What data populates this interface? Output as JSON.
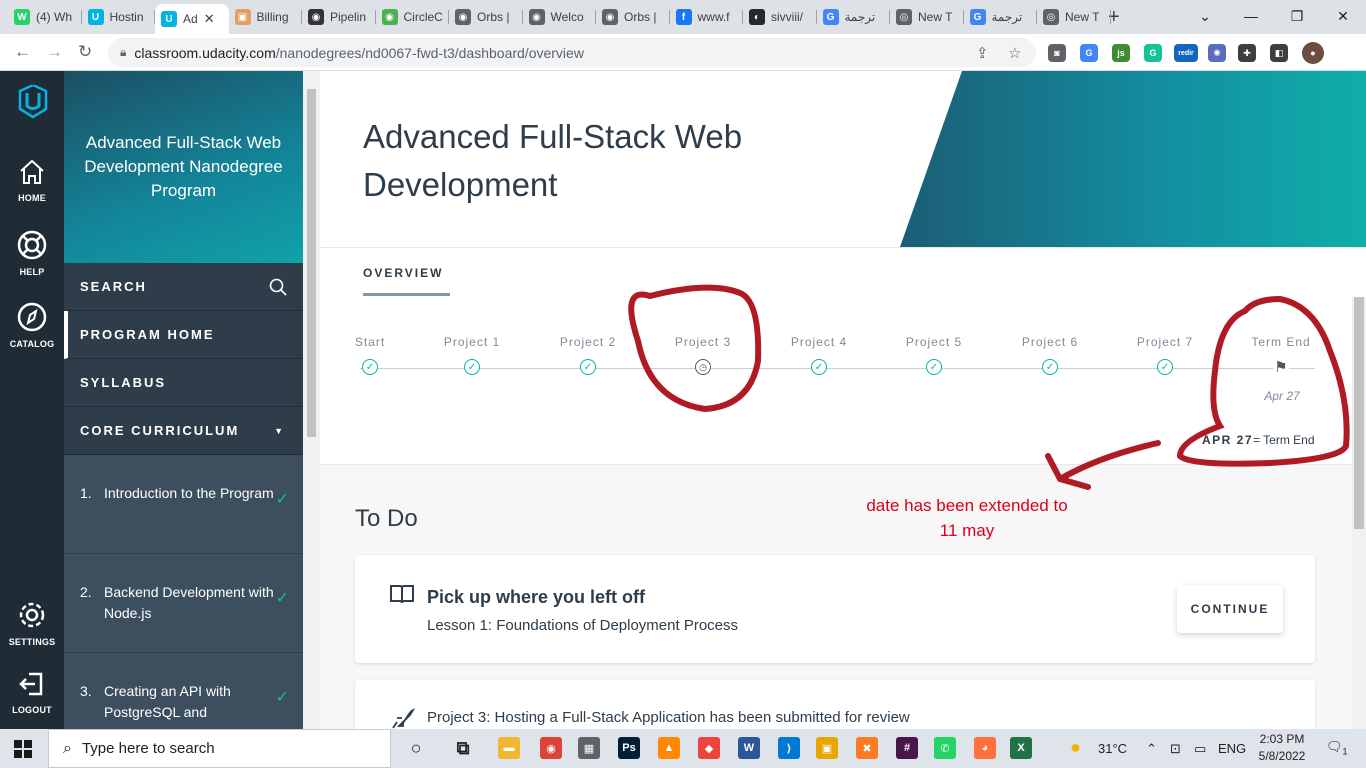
{
  "browser": {
    "tabs": [
      {
        "label": "(4) Wh",
        "icon": "whatsapp-icon",
        "color": "#25d366",
        "glyph": "W"
      },
      {
        "label": "Hostin",
        "icon": "udacity-icon",
        "color": "#02b3e4",
        "glyph": "U"
      },
      {
        "label": "Ad",
        "icon": "udacity-icon",
        "color": "#02b3e4",
        "glyph": "U",
        "active": true
      },
      {
        "label": "Billing",
        "icon": "box-icon",
        "color": "#e0a060",
        "glyph": "▣"
      },
      {
        "label": "Pipelin",
        "icon": "circleci-icon",
        "color": "#343434",
        "glyph": "◉"
      },
      {
        "label": "CircleC",
        "icon": "circleci-green-icon",
        "color": "#4caf50",
        "glyph": "◉"
      },
      {
        "label": "Orbs |",
        "icon": "circleci-icon",
        "color": "#5f6368",
        "glyph": "◉"
      },
      {
        "label": "Welco",
        "icon": "circleci-icon",
        "color": "#5f6368",
        "glyph": "◉"
      },
      {
        "label": "Orbs |",
        "icon": "circleci-icon",
        "color": "#5f6368",
        "glyph": "◉"
      },
      {
        "label": "www.f",
        "icon": "facebook-icon",
        "color": "#1877f2",
        "glyph": "f"
      },
      {
        "label": "sivviii/",
        "icon": "github-icon",
        "color": "#24292e",
        "glyph": "◐"
      },
      {
        "label": "ترجمة",
        "icon": "translate-icon",
        "color": "#4285f4",
        "glyph": "G"
      },
      {
        "label": "New T",
        "icon": "chrome-icon",
        "color": "#5f6368",
        "glyph": "◎"
      },
      {
        "label": "ترجمة",
        "icon": "translate-icon",
        "color": "#4285f4",
        "glyph": "G"
      },
      {
        "label": "New T",
        "icon": "chrome-icon",
        "color": "#5f6368",
        "glyph": "◎"
      }
    ],
    "new_tab": "+",
    "window_controls": {
      "dropdown": "⌄",
      "minimize": "—",
      "restore": "❐",
      "close": "✕"
    },
    "nav": {
      "back": "←",
      "forward": "→",
      "reload": "↻"
    },
    "url_host": "classroom.udacity.com",
    "url_path": "/nanodegrees/nd0067-fwd-t3/dashboard/overview",
    "extensions": [
      {
        "name": "camera-icon",
        "glyph": "◙",
        "color": "#5f6368"
      },
      {
        "name": "translate-ext-icon",
        "glyph": "G",
        "color": "#4285f4"
      },
      {
        "name": "js-ext-icon",
        "glyph": "js",
        "color": "#3c8d2f"
      },
      {
        "name": "grammarly-icon",
        "glyph": "G",
        "color": "#15c39a"
      },
      {
        "name": "redirect-ext-icon",
        "glyph": "redir",
        "color": "#1565c0"
      },
      {
        "name": "gear-ext-icon",
        "glyph": "✺",
        "color": "#5c6bc0",
        "badge": "2"
      },
      {
        "name": "puzzle-icon",
        "glyph": "✚",
        "color": "#3c4043"
      },
      {
        "name": "sidepanel-icon",
        "glyph": "◧",
        "color": "#3c4043"
      },
      {
        "name": "profile-avatar",
        "glyph": "●",
        "color": "#6d4c41"
      }
    ]
  },
  "rail": {
    "items": [
      {
        "label": "HOME",
        "icon": "home-icon"
      },
      {
        "label": "HELP",
        "icon": "lifebuoy-icon"
      },
      {
        "label": "CATALOG",
        "icon": "compass-icon"
      },
      {
        "label": "SETTINGS",
        "icon": "gear-icon"
      },
      {
        "label": "LOGOUT",
        "icon": "logout-icon"
      }
    ]
  },
  "sidebar": {
    "program_title": "Advanced Full-Stack Web Development Nanodegree Program",
    "search_label": "SEARCH",
    "program_home": "PROGRAM HOME",
    "syllabus": "SYLLABUS",
    "core_curriculum": "CORE CURRICULUM",
    "lessons": [
      {
        "num": "1.",
        "title": "Introduction to the Program",
        "done": "✓"
      },
      {
        "num": "2.",
        "title": "Backend Development with Node.js",
        "done": "✓"
      },
      {
        "num": "3.",
        "title": "Creating an API with PostgreSQL and",
        "done": "✓"
      }
    ]
  },
  "main": {
    "title": "Advanced Full-Stack Web Development",
    "overview_tab": "OVERVIEW",
    "timeline": {
      "stops": [
        {
          "label": "Start",
          "status": "done"
        },
        {
          "label": "Project 1",
          "status": "done"
        },
        {
          "label": "Project 2",
          "status": "done"
        },
        {
          "label": "Project 3",
          "status": "current"
        },
        {
          "label": "Project 4",
          "status": "done"
        },
        {
          "label": "Project 5",
          "status": "done"
        },
        {
          "label": "Project 6",
          "status": "done"
        },
        {
          "label": "Project 7",
          "status": "done"
        },
        {
          "label": "Term End",
          "status": "end"
        }
      ],
      "term_end_date": "Apr 27",
      "legend_date": "APR 27",
      "legend_text": "= Term End"
    },
    "todo_title": "To Do",
    "resume_card": {
      "title": "Pick up where you left off",
      "subtitle": "Lesson 1: Foundations of Deployment Process",
      "button": "CONTINUE"
    },
    "project_card": {
      "text": "Project 3: Hosting a Full-Stack Application has been submitted for review"
    },
    "annotation": {
      "line1": "date has been extended to",
      "line2": "11 may",
      "color": "#d9001b"
    }
  },
  "taskbar": {
    "search_placeholder": "Type here to search",
    "apps": [
      {
        "name": "cortana-icon",
        "glyph": "○",
        "color": "#202124"
      },
      {
        "name": "taskview-icon",
        "glyph": "⧉",
        "color": "#202124"
      },
      {
        "name": "file-explorer-icon",
        "glyph": "▬",
        "color": "#f2b632"
      },
      {
        "name": "chrome-taskbar-icon",
        "glyph": "◉",
        "color": "#db4437"
      },
      {
        "name": "calculator-icon",
        "glyph": "▦",
        "color": "#5f6368"
      },
      {
        "name": "photoshop-icon",
        "glyph": "Ps",
        "color": "#001e36"
      },
      {
        "name": "vlc-icon",
        "glyph": "▲",
        "color": "#ff8800"
      },
      {
        "name": "anydesk-icon",
        "glyph": "◆",
        "color": "#ef443b"
      },
      {
        "name": "word-icon",
        "glyph": "W",
        "color": "#2b579a"
      },
      {
        "name": "vscode-icon",
        "glyph": "⟩",
        "color": "#0078d4"
      },
      {
        "name": "sandbox-icon",
        "glyph": "▣",
        "color": "#e6a800"
      },
      {
        "name": "xampp-icon",
        "glyph": "✖",
        "color": "#fb7a24"
      },
      {
        "name": "slack-icon",
        "glyph": "#",
        "color": "#4a154b"
      },
      {
        "name": "whatsapp-taskbar-icon",
        "glyph": "✆",
        "color": "#25d366"
      },
      {
        "name": "firefox-icon",
        "glyph": "◕",
        "color": "#ff7139"
      },
      {
        "name": "excel-icon",
        "glyph": "X",
        "color": "#217346"
      }
    ],
    "weather": "31°C",
    "language": "ENG",
    "time": "2:03 PM",
    "date": "5/8/2022",
    "notification_count": "1"
  }
}
